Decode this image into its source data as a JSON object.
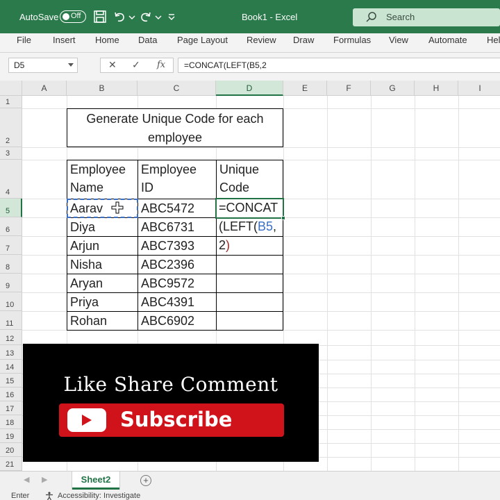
{
  "titlebar": {
    "autosave_label": "AutoSave",
    "autosave_state": "Off",
    "doc_title": "Book1 - Excel",
    "search_placeholder": "Search",
    "color": "#2b7a4b"
  },
  "menu": [
    "File",
    "Insert",
    "Home",
    "Data",
    "Page Layout",
    "Review",
    "Draw",
    "Formulas",
    "View",
    "Automate",
    "Help"
  ],
  "formula_bar": {
    "name_box": "D5",
    "cancel_symbol": "✕",
    "enter_symbol": "✓",
    "fx_symbol": "fx",
    "formula": "=CONCAT(LEFT(B5,2"
  },
  "columns": [
    "A",
    "B",
    "C",
    "D",
    "E",
    "F",
    "G",
    "H",
    "I"
  ],
  "rows": [
    "1",
    "2",
    "3",
    "4",
    "5",
    "6",
    "7",
    "8",
    "9",
    "10",
    "11",
    "12",
    "13",
    "14",
    "15",
    "16",
    "17",
    "18",
    "19",
    "20",
    "21"
  ],
  "sheet": {
    "title_line1": "Generate Unique Code for each",
    "title_line2": "employee",
    "header": {
      "name": [
        "Employee",
        "Name"
      ],
      "id": [
        "Employee",
        "ID"
      ],
      "code": [
        "Unique",
        "Code"
      ]
    },
    "employees": [
      {
        "name": "Aarav",
        "id": "ABC5472"
      },
      {
        "name": "Diya",
        "id": "ABC6731"
      },
      {
        "name": "Arjun",
        "id": "ABC7393"
      },
      {
        "name": "Nisha",
        "id": "ABC2396"
      },
      {
        "name": "Aryan",
        "id": "ABC9572"
      },
      {
        "name": "Priya",
        "id": "ABC4391"
      },
      {
        "name": "Rohan",
        "id": "ABC6902"
      }
    ],
    "editing_formula": {
      "line1": "=CONCAT",
      "line2_text": "(LEFT(",
      "line2_ref": "B5",
      "line2_comma": ",",
      "line3_num": "2",
      "line3_paren": ")"
    }
  },
  "overlay": {
    "tagline": "Like Share Comment",
    "subscribe": "Subscribe"
  },
  "sheet_tab": "Sheet2",
  "status": {
    "mode": "Enter",
    "accessibility": "Accessibility: Investigate"
  },
  "colors": {
    "excel_green": "#217346",
    "ref_blue": "#3a6fc4",
    "paren_red": "#9b2a2a",
    "subscribe_red": "#d0121b"
  }
}
